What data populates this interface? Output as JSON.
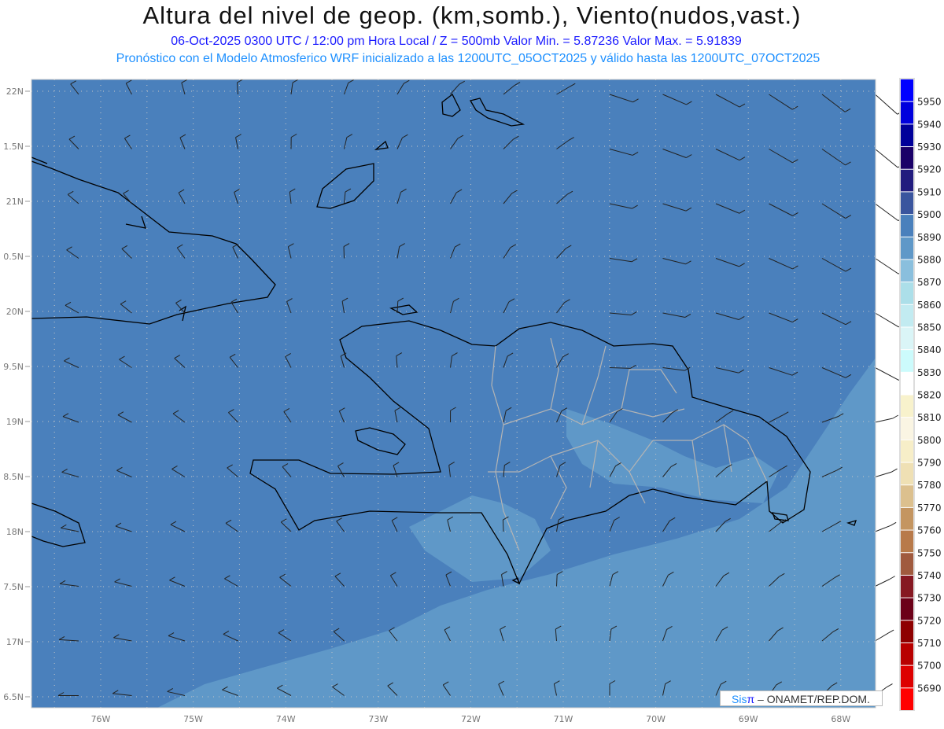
{
  "header": {
    "title": "Altura del nivel de geop. (km,somb.), Viento(nudos,vast.)",
    "subtitle1": "06-Oct-2025  0300 UTC / 12:00 pm Hora Local / Z = 500mb   Valor Min. = 5.87236  Valor Max. = 5.91839",
    "subtitle2": "Pronóstico con el Modelo Atmosferico WRF inicializado a las 1200UTC_05OCT2025 y válido hasta las  1200UTC_07OCT2025"
  },
  "map": {
    "lon_labels": [
      "76W",
      "75W",
      "74W",
      "73W",
      "72W",
      "71W",
      "70W",
      "69W",
      "68W"
    ],
    "lon_values": [
      -76,
      -75,
      -74,
      -73,
      -72,
      -71,
      -70,
      -69,
      -68
    ],
    "lat_labels": [
      "22N",
      "1.5N",
      "21N",
      "0.5N",
      "20N",
      "9.5N",
      "19N",
      "8.5N",
      "18N",
      "7.5N",
      "17N",
      "6.5N"
    ],
    "lat_values": [
      22,
      21.5,
      21,
      20.5,
      20,
      19.5,
      19,
      18.5,
      18,
      17.5,
      17,
      16.5
    ],
    "lon_range": [
      -76.75,
      -67.6
    ],
    "lat_range": [
      16.4,
      22.1
    ],
    "grid": "dotted, every 0.5 degree",
    "shade_main": "#4a80bc",
    "shade_light": "#5f98c8",
    "coast_color": "#000000",
    "province_border_color": "#b0b0b0"
  },
  "colorbar": {
    "labels": [
      "5950",
      "5940",
      "5930",
      "5920",
      "5910",
      "5900",
      "5890",
      "5880",
      "5870",
      "5860",
      "5850",
      "5840",
      "5830",
      "5820",
      "5810",
      "5800",
      "5790",
      "5780",
      "5770",
      "5760",
      "5750",
      "5740",
      "5730",
      "5720",
      "5710",
      "5700",
      "5690"
    ],
    "colors": [
      "#0000ff",
      "#0000dd",
      "#00009a",
      "#1a0068",
      "#221c7e",
      "#3a559e",
      "#4a80bc",
      "#5f98c8",
      "#8abfdd",
      "#acdfe9",
      "#c2ebf1",
      "#daf5f7",
      "#ccfbfc",
      "#ffffff",
      "#f8f2cc",
      "#faf5e3",
      "#f7eec8",
      "#efe0b4",
      "#dcc08e",
      "#c49560",
      "#b87a4a",
      "#a05a3e",
      "#861822",
      "#6c0018",
      "#8e0000",
      "#b80000",
      "#dd0000",
      "#ff0000"
    ]
  },
  "logo": {
    "sis": "Sis",
    "pi": "π",
    "text": " – ONAMET/REP.DOM."
  }
}
